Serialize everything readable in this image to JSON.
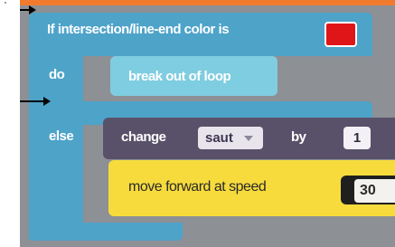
{
  "if_block": {
    "condition_text": "If intersection/line-end color is",
    "condition_color": "#e01518",
    "do_label": "do",
    "else_label": "else"
  },
  "do_block": {
    "label": "break out of loop"
  },
  "else_blocks": {
    "change": {
      "change_label": "change",
      "variable": "saut",
      "by_label": "by",
      "amount": "1"
    },
    "move": {
      "label": "move forward at speed",
      "speed": "30"
    }
  },
  "colors": {
    "if_block": "#4ea3c9",
    "break_block": "#7fcde0",
    "change_block": "#595169",
    "move_block": "#f7db3c",
    "workspace": "#8d9095"
  }
}
